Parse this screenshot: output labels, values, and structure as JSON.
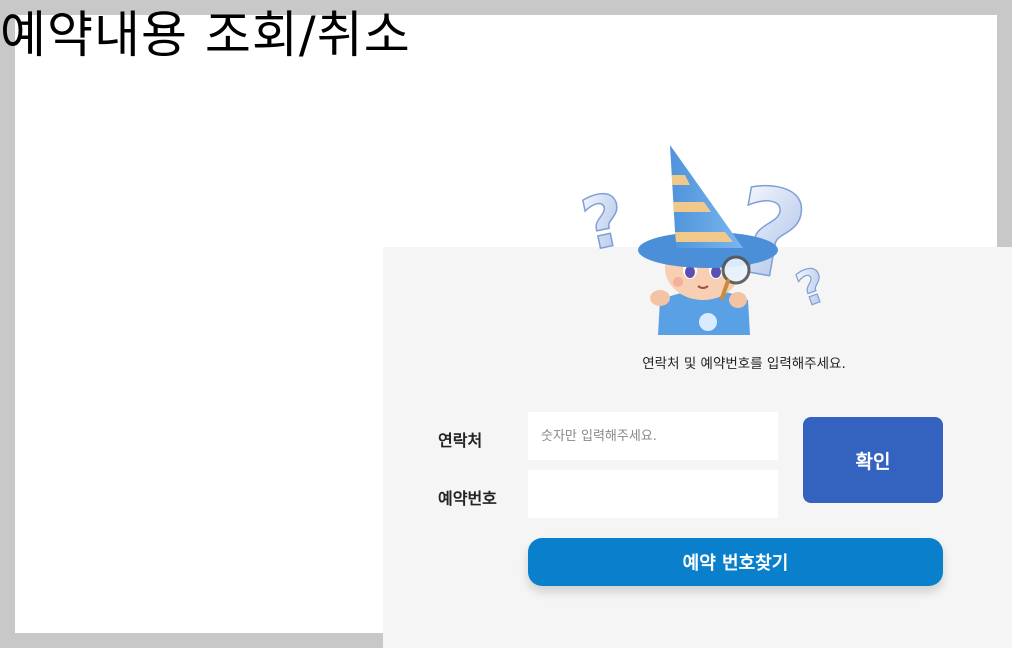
{
  "page": {
    "title": "예약내용 조회/취소"
  },
  "form": {
    "instruction": "연락처 및 예약번호를 입력해주세요.",
    "contact": {
      "label": "연락처",
      "placeholder": "숫자만 입력해주세요.",
      "value": ""
    },
    "reservation_number": {
      "label": "예약번호",
      "placeholder": "",
      "value": ""
    },
    "confirm_label": "확인",
    "find_label": "예약 번호찾기"
  },
  "mascot": {
    "icon": "wizard-mascot-with-magnifier-icon"
  },
  "colors": {
    "confirm_button": "#3362bf",
    "find_button": "#0a80cc",
    "panel_bg": "#f5f5f5",
    "outer_bg": "#c8c8c8"
  }
}
